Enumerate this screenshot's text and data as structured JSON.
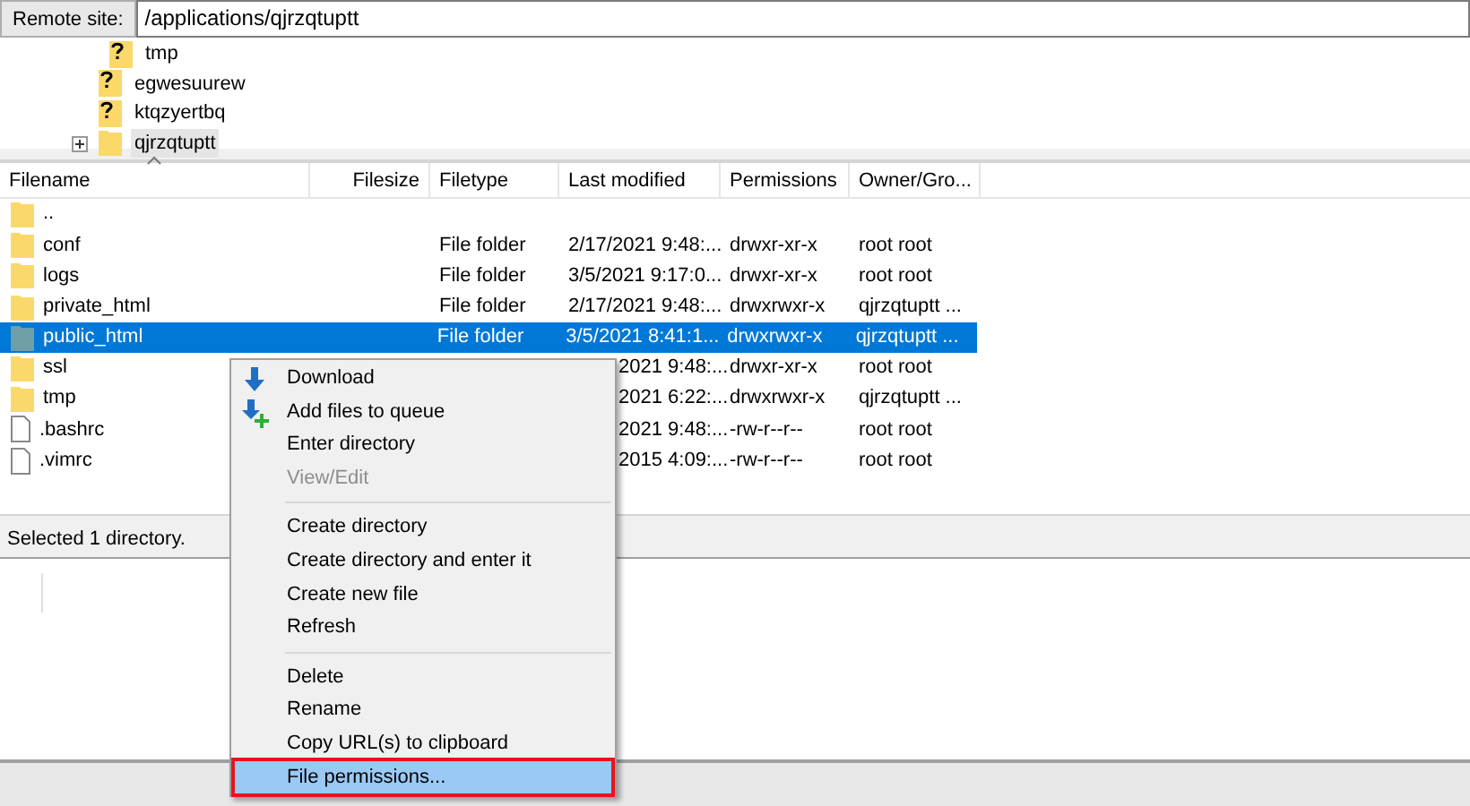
{
  "remote_site": {
    "label": "Remote site:",
    "path": "/applications/qjrzqtuptt"
  },
  "tree": [
    {
      "children": [
        {
          "name": "tmp",
          "kind": "unknown",
          "selected": false
        }
      ]
    },
    {
      "name": "egwesuurew",
      "kind": "unknown",
      "selected": false
    },
    {
      "name": "ktqzyertbq",
      "kind": "unknown",
      "selected": false
    },
    {
      "name": "qjrzqtuptt",
      "kind": "folder",
      "expanded": false,
      "selected": true
    }
  ],
  "table": {
    "columns": [
      "Filename",
      "Filesize",
      "Filetype",
      "Last modified",
      "Permissions",
      "Owner/Gro..."
    ],
    "rows": [
      {
        "kind": "folder",
        "name": "..",
        "selected": false
      },
      {
        "kind": "folder",
        "name": "conf",
        "filetype": "File folder",
        "modified": "2/17/2021 9:48:...",
        "permissions": "drwxr-xr-x",
        "owner": "root root",
        "selected": false
      },
      {
        "kind": "folder",
        "name": "logs",
        "filetype": "File folder",
        "modified": "3/5/2021 9:17:0...",
        "permissions": "drwxr-xr-x",
        "owner": "root root",
        "selected": false
      },
      {
        "kind": "folder",
        "name": "private_html",
        "filetype": "File folder",
        "modified": "2/17/2021 9:48:...",
        "permissions": "drwxrwxr-x",
        "owner": "qjrzqtuptt ...",
        "selected": false
      },
      {
        "kind": "folder",
        "name": "public_html",
        "filetype": "File folder",
        "modified": "3/5/2021 8:41:1...",
        "permissions": "drwxrwxr-x",
        "owner": "qjrzqtuptt ...",
        "selected": true
      },
      {
        "kind": "folder",
        "name": "ssl",
        "modified": "2021 9:48:...",
        "permissions": "drwxr-xr-x",
        "owner": "root root",
        "selected": false
      },
      {
        "kind": "folder",
        "name": "tmp",
        "modified": "2021 6:22:...",
        "permissions": "drwxrwxr-x",
        "owner": "qjrzqtuptt ...",
        "selected": false
      },
      {
        "kind": "file",
        "name": ".bashrc",
        "modified": "2021 9:48:...",
        "permissions": "-rw-r--r--",
        "owner": "root root",
        "selected": false
      },
      {
        "kind": "file",
        "name": ".vimrc",
        "modified": "2015 4:09:...",
        "permissions": "-rw-r--r--",
        "owner": "root root",
        "selected": false
      }
    ]
  },
  "status_bar": "Selected 1 directory.",
  "context_menu": [
    {
      "label": "Download",
      "kind": "item",
      "disabled": false,
      "selected": false
    },
    {
      "label": "Add files to queue",
      "kind": "item",
      "disabled": false,
      "selected": false
    },
    {
      "label": "Enter directory",
      "kind": "item",
      "disabled": false,
      "selected": false
    },
    {
      "label": "View/Edit",
      "kind": "item",
      "disabled": true,
      "selected": false
    },
    {
      "kind": "separator"
    },
    {
      "label": "Create directory",
      "kind": "item",
      "disabled": false,
      "selected": false
    },
    {
      "label": "Create directory and enter it",
      "kind": "item",
      "disabled": false,
      "selected": false
    },
    {
      "label": "Create new file",
      "kind": "item",
      "disabled": false,
      "selected": false
    },
    {
      "label": "Refresh",
      "kind": "item",
      "disabled": false,
      "selected": false
    },
    {
      "kind": "separator"
    },
    {
      "label": "Delete",
      "kind": "item",
      "disabled": false,
      "selected": false
    },
    {
      "label": "Rename",
      "kind": "item",
      "disabled": false,
      "selected": false
    },
    {
      "label": "Copy URL(s) to clipboard",
      "kind": "item",
      "disabled": false,
      "selected": false
    },
    {
      "label": "File permissions...",
      "kind": "item",
      "disabled": false,
      "selected": true
    }
  ]
}
